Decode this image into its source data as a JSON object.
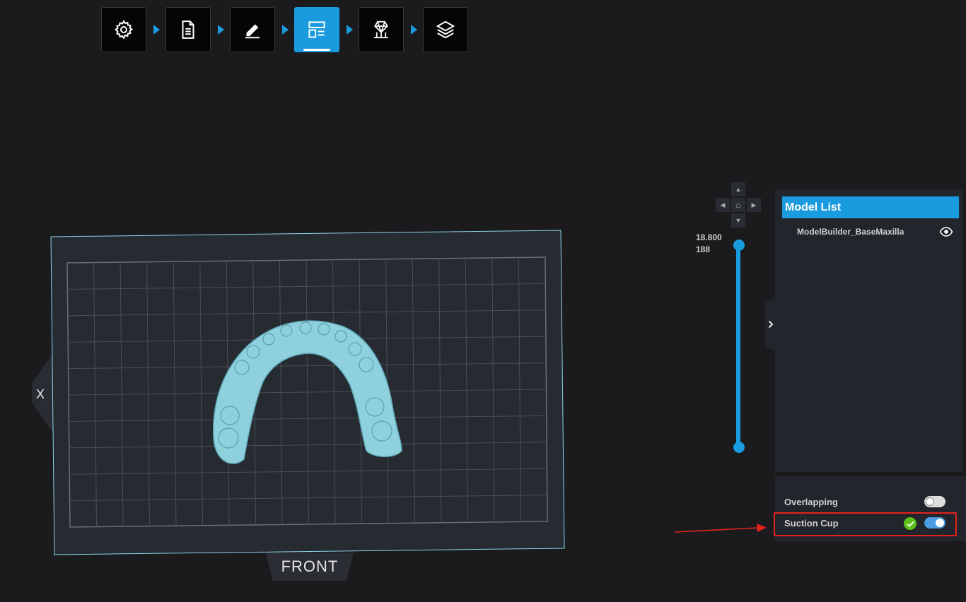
{
  "toolbar": {
    "steps": [
      {
        "name": "settings",
        "icon": "gear-icon",
        "active": false
      },
      {
        "name": "document",
        "icon": "document-icon",
        "active": false
      },
      {
        "name": "edit",
        "icon": "pencil-icon",
        "active": false
      },
      {
        "name": "layout",
        "icon": "layout-icon",
        "active": true
      },
      {
        "name": "support",
        "icon": "support-structure-icon",
        "active": false
      },
      {
        "name": "slice",
        "icon": "layers-icon",
        "active": false
      }
    ],
    "accent_color": "#1a9be0"
  },
  "viewport": {
    "side_label": "X",
    "front_label": "FRONT",
    "model_color": "#8fd0dd"
  },
  "slider": {
    "max_value": "18.800",
    "layer_count": "188"
  },
  "model_list": {
    "title": "Model List",
    "items": [
      {
        "name": "ModelBuilder_BaseMaxilla",
        "visible": true
      }
    ]
  },
  "options": {
    "overlapping": {
      "label": "Overlapping",
      "enabled": false
    },
    "suction_cup": {
      "label": "Suction Cup",
      "enabled": true,
      "status": "ok"
    }
  },
  "annotation": {
    "highlight_color": "#e4221b",
    "target": "suction_cup"
  }
}
